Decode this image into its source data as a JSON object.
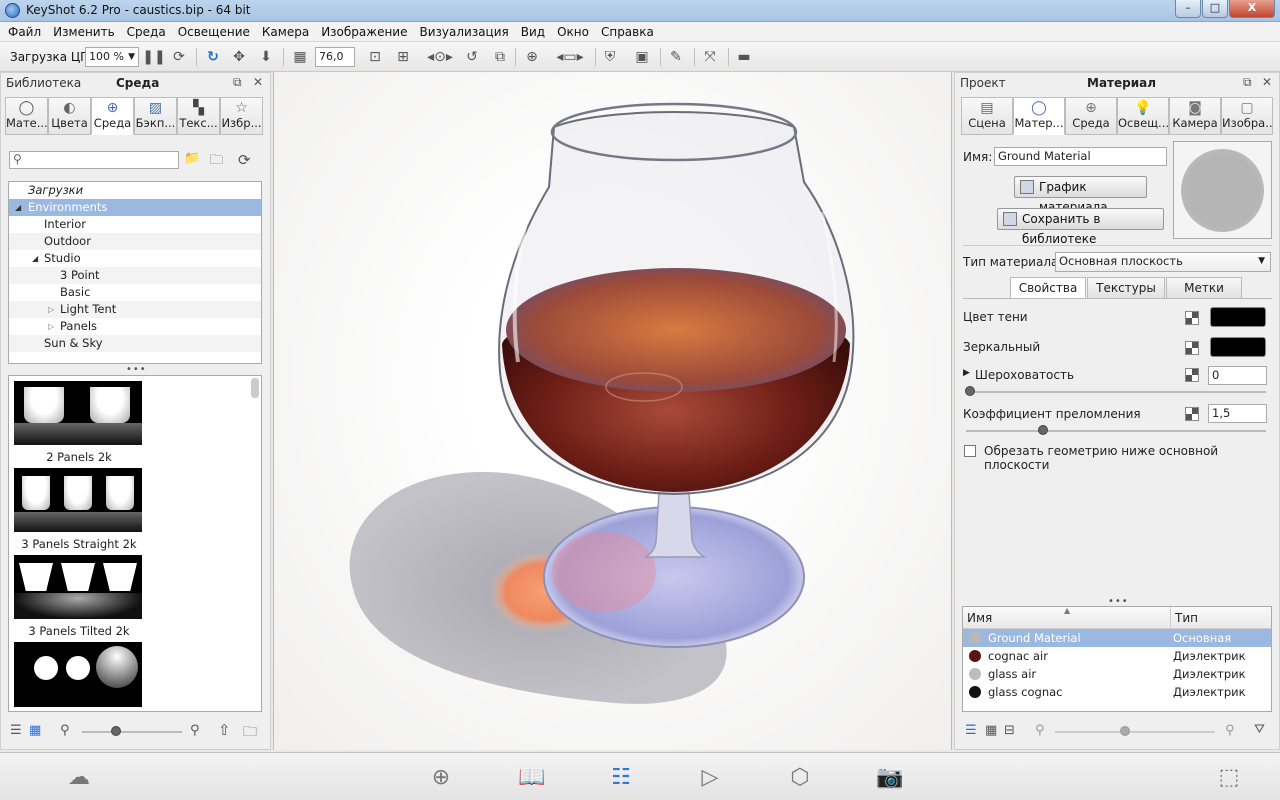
{
  "window": {
    "title": "KeyShot 6.2 Pro  - caustics.bip  - 64 bit",
    "min": "–",
    "max": "□",
    "close": "X"
  },
  "menu": [
    "Файл",
    "Изменить",
    "Среда",
    "Освещение",
    "Камера",
    "Изображение",
    "Визуализация",
    "Вид",
    "Окно",
    "Справка"
  ],
  "toolbar": {
    "cpu_label": "Загрузка ЦП",
    "cpu_value": "100 %",
    "fov_value": "76,0"
  },
  "left_panel": {
    "header_left": "Библиотека",
    "header_title": "Среда",
    "tabs": [
      {
        "label": "Мате...",
        "icon": "material-icon"
      },
      {
        "label": "Цвета",
        "icon": "colors-icon"
      },
      {
        "label": "Среда",
        "icon": "environment-icon"
      },
      {
        "label": "Бэкп...",
        "icon": "backplate-icon"
      },
      {
        "label": "Текс...",
        "icon": "texture-icon"
      },
      {
        "label": "Избр...",
        "icon": "favorites-icon"
      }
    ],
    "tree": [
      {
        "label": "Загрузки",
        "indent": 0,
        "italic": true
      },
      {
        "label": "Environments",
        "indent": 0,
        "selected": true,
        "expanded": true
      },
      {
        "label": "Interior",
        "indent": 1
      },
      {
        "label": "Outdoor",
        "indent": 1
      },
      {
        "label": "Studio",
        "indent": 1,
        "expanded": true
      },
      {
        "label": "3 Point",
        "indent": 2
      },
      {
        "label": "Basic",
        "indent": 2
      },
      {
        "label": "Light Tent",
        "indent": 2,
        "collapsed": true
      },
      {
        "label": "Panels",
        "indent": 2,
        "collapsed": true
      },
      {
        "label": "Sun & Sky",
        "indent": 1
      }
    ],
    "thumbnails": [
      {
        "label": "2 Panels 2k"
      },
      {
        "label": "3 Panels Straight 2k"
      },
      {
        "label": "3 Panels Tilted 2k"
      },
      {
        "label": ""
      }
    ]
  },
  "right_panel": {
    "header_left": "Проект",
    "header_title": "Материал",
    "tabs": [
      {
        "label": "Сцена",
        "icon": "scene-icon"
      },
      {
        "label": "Матер...",
        "icon": "material-icon"
      },
      {
        "label": "Среда",
        "icon": "environment-icon"
      },
      {
        "label": "Освещ...",
        "icon": "lighting-icon"
      },
      {
        "label": "Камера",
        "icon": "camera-icon"
      },
      {
        "label": "Изобра...",
        "icon": "image-icon"
      }
    ],
    "name_label": "Имя:",
    "name_value": "Ground Material",
    "graph_button": "График материала",
    "save_button": "Сохранить в библиотеке",
    "type_label": "Тип материала:",
    "type_value": "Основная плоскость",
    "subtabs": [
      "Свойства",
      "Текстуры",
      "Метки"
    ],
    "shadow_color_label": "Цвет тени",
    "specular_label": "Зеркальный",
    "roughness_label": "Шероховатость",
    "roughness_value": "0",
    "ior_label": "Коэффициент преломления",
    "ior_value": "1,5",
    "clip_label": "Обрезать геометрию ниже основной плоскости",
    "table_headers": [
      "Имя",
      "Тип"
    ],
    "materials": [
      {
        "name": "Ground Material",
        "type": "Основная плоско",
        "color": "#b8b8b8"
      },
      {
        "name": "cognac air",
        "type": "Диэлектрик",
        "color": "#5a1512"
      },
      {
        "name": "glass air",
        "type": "Диэлектрик",
        "color": "#bdbdbd"
      },
      {
        "name": "glass cognac",
        "type": "Диэлектрик",
        "color": "#111111"
      }
    ]
  },
  "bottom": {
    "icons": [
      "cloud-icon",
      "import-icon",
      "library-icon",
      "project-icon",
      "animation-icon",
      "keyshotvr-icon",
      "render-icon",
      "region-icon"
    ]
  }
}
